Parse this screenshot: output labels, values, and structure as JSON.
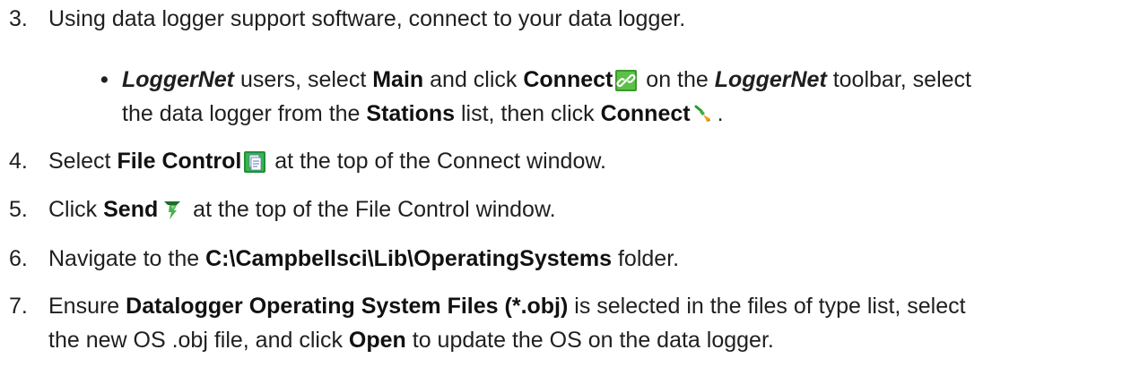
{
  "steps": [
    {
      "number": "3.",
      "text": "Using data logger support software, connect to your data logger."
    },
    {
      "number": "4.",
      "pre": "Select ",
      "bold": "File Control",
      "post": " at the top of the Connect window."
    },
    {
      "number": "5.",
      "pre": "Click ",
      "bold": "Send",
      "post": " at the top of the File Control window."
    },
    {
      "number": "6.",
      "pre": "Navigate to the ",
      "bold": "C:\\Campbellsci\\Lib\\OperatingSystems",
      "post": " folder."
    },
    {
      "number": "7.",
      "pre": "Ensure ",
      "bold": "Datalogger Operating System Files (*.obj)",
      "mid": " is selected in the files of type list, select",
      "line2_pre": "the new OS .obj file, and click ",
      "line2_bold": "Open",
      "line2_post": " to update the OS on the data logger."
    }
  ],
  "bullet": {
    "dot": "•",
    "italic1": "LoggerNet",
    "t1": " users, select ",
    "b1": "Main",
    "t2": " and click ",
    "b2": "Connect",
    "t3": " on the ",
    "italic2": "LoggerNet",
    "t4": " toolbar, select",
    "t5": "the data logger from the ",
    "b3": "Stations",
    "t6": " list, then click ",
    "b4": "Connect",
    "t7": "."
  },
  "icons": {
    "connect_toolbar": "link-icon",
    "connect_station": "plug-icon",
    "file_control": "file-control-icon",
    "send": "send-icon"
  }
}
